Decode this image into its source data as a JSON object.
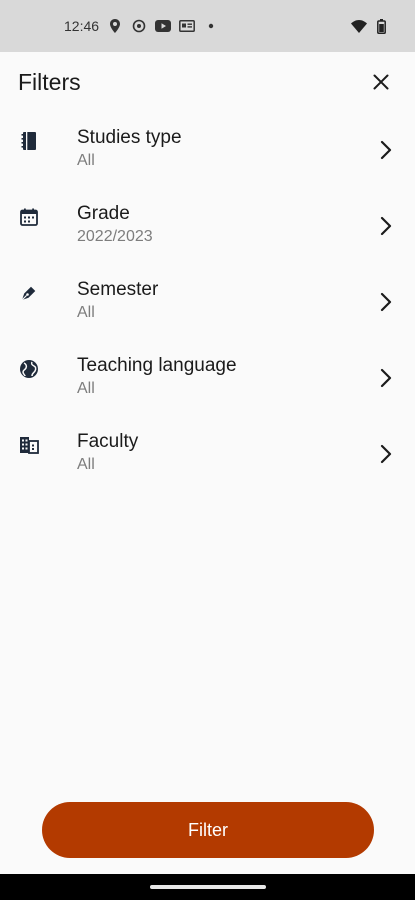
{
  "status_bar": {
    "time": "12:46",
    "icons": [
      "location-icon",
      "settings-icon",
      "youtube-icon",
      "news-icon",
      "dot-icon",
      "wifi-icon",
      "battery-icon"
    ]
  },
  "header": {
    "title": "Filters",
    "close_icon": "close-icon"
  },
  "filters": [
    {
      "label": "Studies type",
      "value": "All",
      "icon": "book-icon"
    },
    {
      "label": "Grade",
      "value": "2022/2023",
      "icon": "calendar-icon"
    },
    {
      "label": "Semester",
      "value": "All",
      "icon": "pen-icon"
    },
    {
      "label": "Teaching language",
      "value": "All",
      "icon": "globe-icon"
    },
    {
      "label": "Faculty",
      "value": "All",
      "icon": "building-icon"
    }
  ],
  "filter_button": {
    "label": "Filter"
  },
  "colors": {
    "accent": "#b33a00",
    "background": "#fafafa",
    "status_bar": "#d9d9d9",
    "secondary_text": "#7d7d7d"
  }
}
